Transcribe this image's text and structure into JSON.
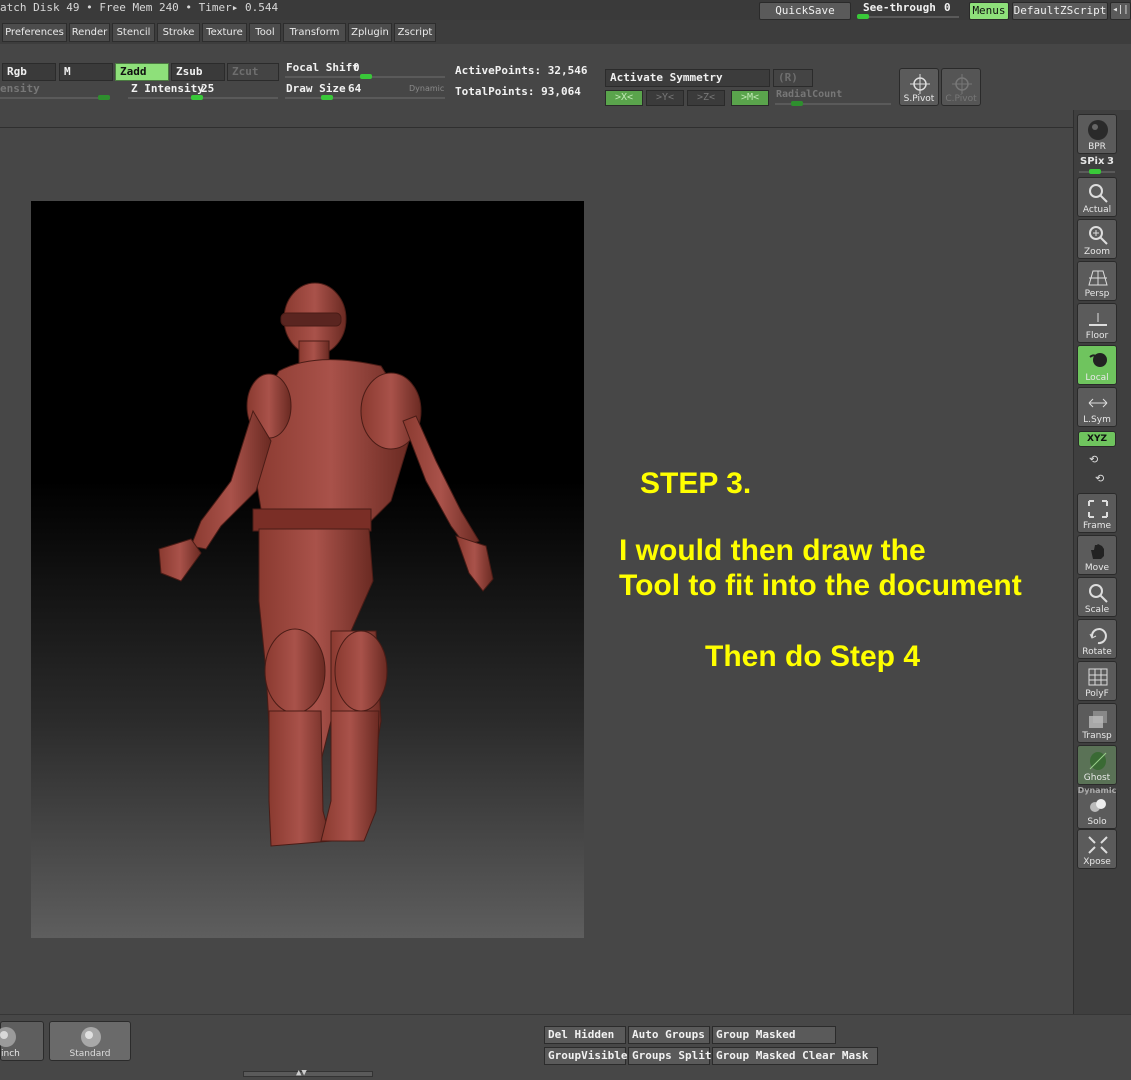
{
  "status": {
    "text": "atch Disk 49 • Free Mem 240 • Timer▸ 0.544"
  },
  "topbar": {
    "quicksave": "QuickSave",
    "seethrough_label": "See-through",
    "seethrough_value": "0",
    "seethrough_level": 0,
    "menus": "Menus",
    "zscript": "DefaultZScript"
  },
  "menu": [
    "Preferences",
    "Render",
    "Stencil",
    "Stroke",
    "Texture",
    "Tool",
    "Transform",
    "Zplugin",
    "Zscript"
  ],
  "toolbar": {
    "rgb": "Rgb",
    "m": "M",
    "zadd": "Zadd",
    "zsub": "Zsub",
    "zcut": "Zcut",
    "rgb_intensity": "ensity",
    "z_intensity_label": "Z Intensity",
    "z_intensity_value": "25",
    "focal_shift_label": "Focal Shift",
    "focal_shift_value": "0",
    "draw_size_label": "Draw Size",
    "draw_size_value": "64",
    "dynamic": "Dynamic",
    "active_points_label": "ActivePoints:",
    "active_points": "32,546",
    "total_points_label": "TotalPoints:",
    "total_points": "93,064",
    "activate_symmetry": "Activate Symmetry",
    "r": "(R)",
    "x_axis": ">X<",
    "y_axis": ">Y<",
    "z_axis": ">Z<",
    "m_axis": ">M<",
    "radial_count": "RadialCount",
    "spivot": "S.Pivot",
    "cpivot": "C.Pivot"
  },
  "shelf": {
    "bpr": "BPR",
    "spix_label": "SPix",
    "spix_value": "3",
    "actual": "Actual",
    "zoom": "Zoom",
    "persp": "Persp",
    "floor": "Floor",
    "local": "Local",
    "lsym": "L.Sym",
    "xyz": "XYZ",
    "frame": "Frame",
    "move": "Move",
    "scale": "Scale",
    "rotate": "Rotate",
    "polyf": "PolyF",
    "transp": "Transp",
    "ghost": "Ghost",
    "dynamic": "Dynamic",
    "solo": "Solo",
    "xpose": "Xpose"
  },
  "caption": {
    "step": "STEP 3.",
    "line1": "I would then draw the",
    "line2": "Tool to fit into the document",
    "line3": "Then do Step 4"
  },
  "bottom": {
    "pinch": "inch",
    "standard": "Standard",
    "del_hidden": "Del Hidden",
    "auto_groups": "Auto Groups",
    "group_masked": "Group Masked",
    "group_visible": "GroupVisible",
    "groups_split": "Groups Split",
    "group_masked_clear_mask": "Group Masked Clear Mask"
  }
}
